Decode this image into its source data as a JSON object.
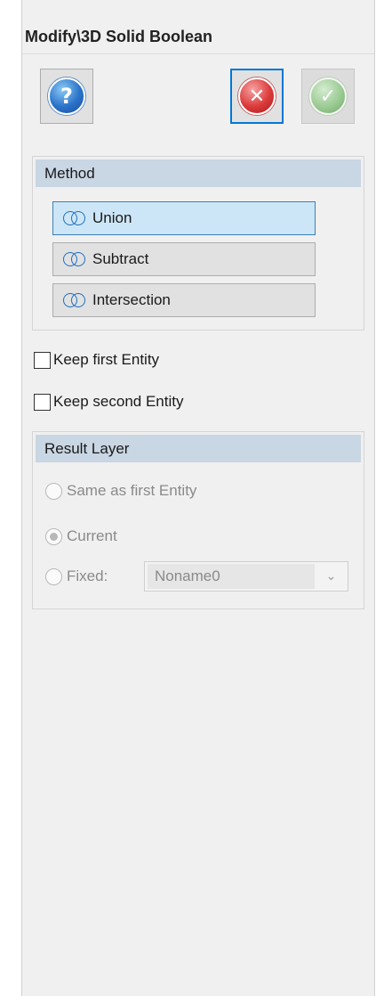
{
  "title": "Modify\\3D Solid Boolean",
  "toolbar": {
    "help_glyph": "?",
    "cancel_glyph": "✕",
    "ok_glyph": "✓"
  },
  "method": {
    "heading": "Method",
    "options": [
      {
        "label": "Union",
        "active": true
      },
      {
        "label": "Subtract",
        "active": false
      },
      {
        "label": "Intersection",
        "active": false
      }
    ]
  },
  "options": {
    "keep_first": "Keep first Entity",
    "keep_second": "Keep second Entity"
  },
  "result_layer": {
    "heading": "Result Layer",
    "same_as_first": "Same as first Entity",
    "current": "Current",
    "fixed": "Fixed:",
    "fixed_value": "Noname0",
    "selected": "current"
  },
  "colors": {
    "panel_bg": "#f0f0f0",
    "group_header": "#c9d6e3",
    "active_method": "#cde6f7",
    "focus_border": "#0078d7"
  }
}
